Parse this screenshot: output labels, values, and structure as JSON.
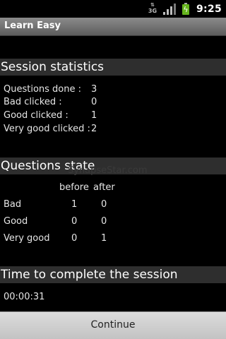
{
  "status_bar": {
    "network_type": "3G",
    "time": "9:25"
  },
  "app": {
    "title": "Learn Easy"
  },
  "session_statistics": {
    "header": "Session statistics",
    "rows": [
      {
        "label": "Questions done :",
        "value": "3"
      },
      {
        "label": "Bad clicked :",
        "value": "0"
      },
      {
        "label": "Good clicked :",
        "value": "1"
      },
      {
        "label": "Very good clicked :",
        "value": "2"
      }
    ]
  },
  "questions_state": {
    "header": "Questions state",
    "columns": [
      "before",
      "after"
    ],
    "rows": [
      {
        "label": "Bad",
        "before": "1",
        "after": "0"
      },
      {
        "label": "Good",
        "before": "0",
        "after": "0"
      },
      {
        "label": "Very good",
        "before": "0",
        "after": "1"
      }
    ]
  },
  "watermark": "SynapseStar.com",
  "time_section": {
    "header": "Time to complete the session",
    "value": "00:00:31"
  },
  "continue_button": {
    "label": "Continue"
  },
  "colors": {
    "background": "#000000",
    "section_header": "#2e2e2e",
    "battery": "#66b51e",
    "button": "#d0d0d0"
  },
  "icons": [
    "network-3g-icon",
    "signal-icon",
    "battery-charging-icon"
  ]
}
